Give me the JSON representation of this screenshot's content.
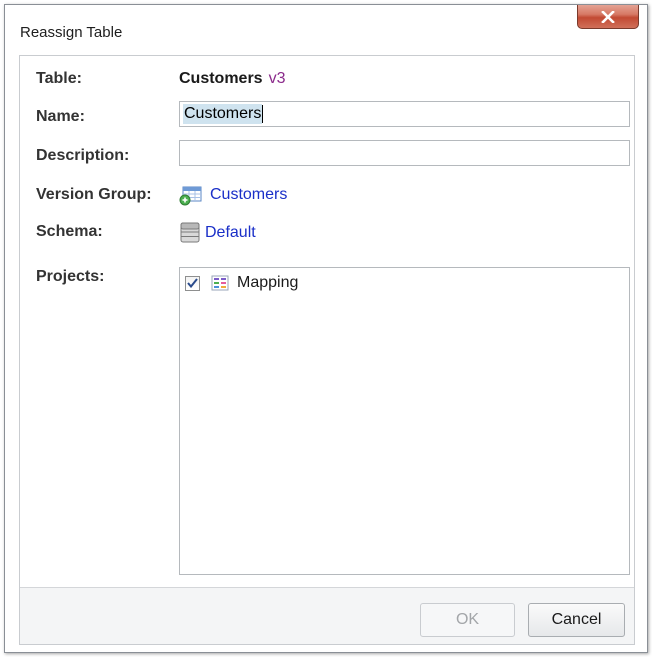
{
  "window": {
    "title": "Reassign Table"
  },
  "form": {
    "table_label": "Table:",
    "table_name": "Customers",
    "table_version": "v3",
    "name_label": "Name:",
    "name_value": "Customers",
    "description_label": "Description:",
    "description_value": "",
    "version_group_label": "Version Group:",
    "version_group_link": "Customers",
    "schema_label": "Schema:",
    "schema_link": "Default",
    "projects_label": "Projects:",
    "projects": [
      {
        "label": "Mapping",
        "checked": true
      }
    ]
  },
  "buttons": {
    "ok_label": "OK",
    "ok_enabled": false,
    "cancel_label": "Cancel"
  },
  "icons": {
    "close": "close-icon",
    "version_group": "version-group-icon",
    "schema": "database-icon",
    "project": "mapping-project-icon"
  },
  "colors": {
    "link": "#1a2fc8",
    "version_tag": "#8b2a8b",
    "close_button": "#c94a33"
  }
}
